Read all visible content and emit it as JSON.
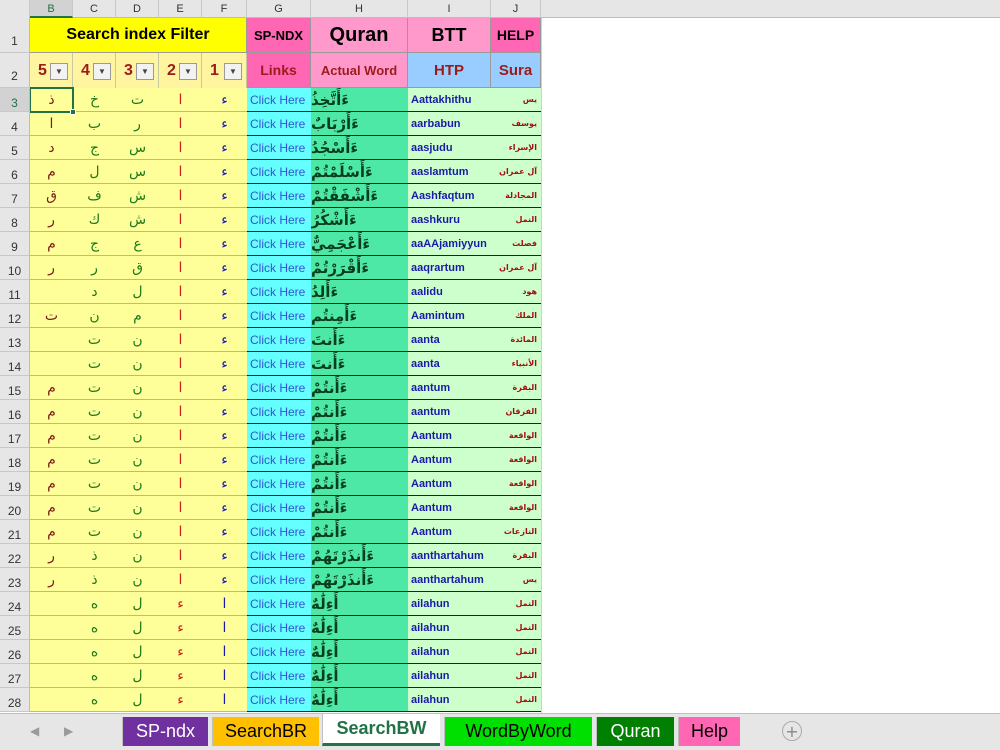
{
  "columns": [
    "B",
    "C",
    "D",
    "E",
    "F",
    "G",
    "H",
    "I",
    "J"
  ],
  "header": {
    "search_filter": "Search index Filter",
    "sp_ndx": "SP-NDX",
    "quran": "Quran",
    "btt": "BTT",
    "help": "HELP",
    "filters": [
      "5",
      "4",
      "3",
      "2",
      "1"
    ],
    "links": "Links",
    "actual_word": "Actual Word",
    "htp": "HTP",
    "sura": "Sura"
  },
  "rows": [
    {
      "n": "3",
      "l5": "ذ",
      "l4": "خ",
      "l3": "ت",
      "l2": "ا",
      "l1": "ء",
      "link": "Click Here",
      "word": "ءَأَتَّخِذُ",
      "htp": "Aattakhithu",
      "sura": "يس"
    },
    {
      "n": "4",
      "l5": "ا",
      "l4": "ب",
      "l3": "ر",
      "l2": "ا",
      "l1": "ء",
      "link": "Click Here",
      "word": "ءَأَرْبَابٌ",
      "htp": "aarbabun",
      "sura": "يوسف"
    },
    {
      "n": "5",
      "l5": "د",
      "l4": "ج",
      "l3": "س",
      "l2": "ا",
      "l1": "ء",
      "link": "Click Here",
      "word": "ءَأَسْجُدُ",
      "htp": "aasjudu",
      "sura": "الإسراء"
    },
    {
      "n": "6",
      "l5": "م",
      "l4": "ل",
      "l3": "س",
      "l2": "ا",
      "l1": "ء",
      "link": "Click Here",
      "word": "ءَأَسْلَمْتُمْ",
      "htp": "aaslamtum",
      "sura": "آل عمران"
    },
    {
      "n": "7",
      "l5": "ق",
      "l4": "ف",
      "l3": "ش",
      "l2": "ا",
      "l1": "ء",
      "link": "Click Here",
      "word": "ءَأَشْفَقْتُمْ",
      "htp": "Aashfaqtum",
      "sura": "المجادلة"
    },
    {
      "n": "8",
      "l5": "ر",
      "l4": "ك",
      "l3": "ش",
      "l2": "ا",
      "l1": "ء",
      "link": "Click Here",
      "word": "ءَأَشْكُرُ",
      "htp": "aashkuru",
      "sura": "النمل"
    },
    {
      "n": "9",
      "l5": "م",
      "l4": "ج",
      "l3": "ع",
      "l2": "ا",
      "l1": "ء",
      "link": "Click Here",
      "word": "ءَأَعْجَمِيٌّ",
      "htp": "aaAAjamiyyun",
      "sura": "فصلت"
    },
    {
      "n": "10",
      "l5": "ر",
      "l4": "ر",
      "l3": "ق",
      "l2": "ا",
      "l1": "ء",
      "link": "Click Here",
      "word": "ءَأَقْرَرْتُمْ",
      "htp": "aaqrartum",
      "sura": "آل عمران"
    },
    {
      "n": "11",
      "l5": "",
      "l4": "د",
      "l3": "ل",
      "l2": "ا",
      "l1": "ء",
      "link": "Click Here",
      "word": "ءَأَلِدُ",
      "htp": "aalidu",
      "sura": "هود"
    },
    {
      "n": "12",
      "l5": "ت",
      "l4": "ن",
      "l3": "م",
      "l2": "ا",
      "l1": "ء",
      "link": "Click Here",
      "word": "ءَأَمِنتُم",
      "htp": "Aamintum",
      "sura": "الملك"
    },
    {
      "n": "13",
      "l5": "",
      "l4": "ت",
      "l3": "ن",
      "l2": "ا",
      "l1": "ء",
      "link": "Click Here",
      "word": "ءَأَنتَ",
      "htp": "aanta",
      "sura": "المائدة"
    },
    {
      "n": "14",
      "l5": "",
      "l4": "ت",
      "l3": "ن",
      "l2": "ا",
      "l1": "ء",
      "link": "Click Here",
      "word": "ءَأَنتَ",
      "htp": "aanta",
      "sura": "الأنبياء"
    },
    {
      "n": "15",
      "l5": "م",
      "l4": "ت",
      "l3": "ن",
      "l2": "ا",
      "l1": "ء",
      "link": "Click Here",
      "word": "ءَأَنتُمْ",
      "htp": "aantum",
      "sura": "البقرة"
    },
    {
      "n": "16",
      "l5": "م",
      "l4": "ت",
      "l3": "ن",
      "l2": "ا",
      "l1": "ء",
      "link": "Click Here",
      "word": "ءَأَنتُمْ",
      "htp": "aantum",
      "sura": "الفرقان"
    },
    {
      "n": "17",
      "l5": "م",
      "l4": "ت",
      "l3": "ن",
      "l2": "ا",
      "l1": "ء",
      "link": "Click Here",
      "word": "ءَأَنتُمْ",
      "htp": "Aantum",
      "sura": "الواقعة"
    },
    {
      "n": "18",
      "l5": "م",
      "l4": "ت",
      "l3": "ن",
      "l2": "ا",
      "l1": "ء",
      "link": "Click Here",
      "word": "ءَأَنتُمْ",
      "htp": "Aantum",
      "sura": "الواقعة"
    },
    {
      "n": "19",
      "l5": "م",
      "l4": "ت",
      "l3": "ن",
      "l2": "ا",
      "l1": "ء",
      "link": "Click Here",
      "word": "ءَأَنتُمْ",
      "htp": "Aantum",
      "sura": "الواقعة"
    },
    {
      "n": "20",
      "l5": "م",
      "l4": "ت",
      "l3": "ن",
      "l2": "ا",
      "l1": "ء",
      "link": "Click Here",
      "word": "ءَأَنتُمْ",
      "htp": "Aantum",
      "sura": "الواقعة"
    },
    {
      "n": "21",
      "l5": "م",
      "l4": "ت",
      "l3": "ن",
      "l2": "ا",
      "l1": "ء",
      "link": "Click Here",
      "word": "ءَأَنتُمْ",
      "htp": "Aantum",
      "sura": "النازعات"
    },
    {
      "n": "22",
      "l5": "ر",
      "l4": "ذ",
      "l3": "ن",
      "l2": "ا",
      "l1": "ء",
      "link": "Click Here",
      "word": "ءَأَنذَرْتَهُمْ",
      "htp": "aanthartahum",
      "sura": "البقرة"
    },
    {
      "n": "23",
      "l5": "ر",
      "l4": "ذ",
      "l3": "ن",
      "l2": "ا",
      "l1": "ء",
      "link": "Click Here",
      "word": "ءَأَنذَرْتَهُمْ",
      "htp": "aanthartahum",
      "sura": "يس"
    },
    {
      "n": "24",
      "l5": "",
      "l4": "ه",
      "l3": "ل",
      "l2": "ء",
      "l1": "ا",
      "link": "Click Here",
      "word": "أَءِلَٰهٌ",
      "htp": "ailahun",
      "sura": "النمل"
    },
    {
      "n": "25",
      "l5": "",
      "l4": "ه",
      "l3": "ل",
      "l2": "ء",
      "l1": "ا",
      "link": "Click Here",
      "word": "أَءِلَٰهٌ",
      "htp": "ailahun",
      "sura": "النمل"
    },
    {
      "n": "26",
      "l5": "",
      "l4": "ه",
      "l3": "ل",
      "l2": "ء",
      "l1": "ا",
      "link": "Click Here",
      "word": "أَءِلَٰهٌ",
      "htp": "ailahun",
      "sura": "النمل"
    },
    {
      "n": "27",
      "l5": "",
      "l4": "ه",
      "l3": "ل",
      "l2": "ء",
      "l1": "ا",
      "link": "Click Here",
      "word": "أَءِلَٰهٌ",
      "htp": "ailahun",
      "sura": "النمل"
    },
    {
      "n": "28",
      "l5": "",
      "l4": "ه",
      "l3": "ل",
      "l2": "ء",
      "l1": "ا",
      "link": "Click Here",
      "word": "أَءِلَٰهٌ",
      "htp": "ailahun",
      "sura": "النمل"
    }
  ],
  "tabs": [
    {
      "label": "SP-ndx",
      "bg": "#7030a0",
      "fg": "#ffffff"
    },
    {
      "label": "SearchBR",
      "bg": "#ffc000",
      "fg": "#000000"
    },
    {
      "label": "SearchBW",
      "bg": "#ffffff",
      "fg": "#217346"
    },
    {
      "label": "WordByWord",
      "bg": "#00e000",
      "fg": "#000000"
    },
    {
      "label": "Quran",
      "bg": "#008000",
      "fg": "#ffffff"
    },
    {
      "label": "Help",
      "bg": "#ff66b3",
      "fg": "#000000"
    }
  ],
  "add_sheet": "+",
  "colors": {
    "accent": "#217346",
    "yellow": "#ffff99",
    "cyan": "#66ffff",
    "green": "#4ee8a6",
    "lightgreen": "#ccffcc"
  }
}
